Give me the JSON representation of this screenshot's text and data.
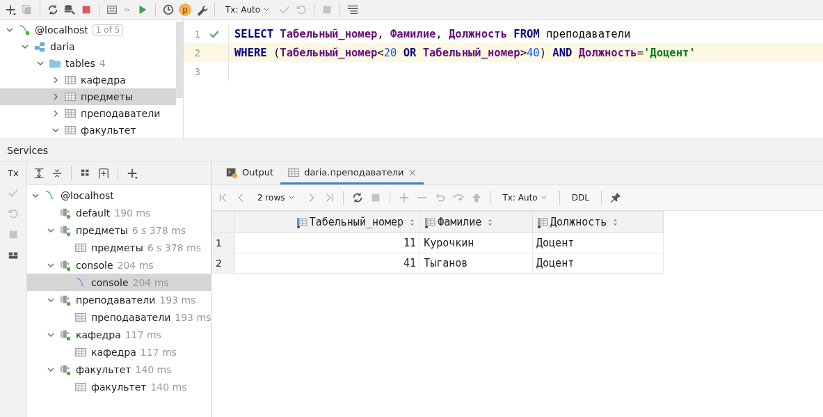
{
  "toolbar": {
    "profile_badge": "p",
    "tx_mode": "Tx: Auto"
  },
  "db_tree": [
    {
      "label": "@localhost",
      "kind": "host",
      "badge": "1 of 5",
      "expanded": true,
      "selected": false,
      "children": [
        {
          "label": "daria",
          "kind": "schema",
          "expanded": true,
          "selected": false,
          "children": [
            {
              "label": "tables",
              "kind": "folder",
              "count": "4",
              "expanded": true,
              "selected": false,
              "children": [
                {
                  "label": "кафедра",
                  "kind": "table",
                  "expanded": false,
                  "selected": false
                },
                {
                  "label": "предметы",
                  "kind": "table",
                  "expanded": false,
                  "selected": true
                },
                {
                  "label": "преподаватели",
                  "kind": "table",
                  "expanded": false,
                  "selected": false
                },
                {
                  "label": "факультет",
                  "kind": "table",
                  "expanded": true,
                  "selected": false
                }
              ]
            }
          ]
        }
      ]
    }
  ],
  "editor": {
    "lines": [
      {
        "number": "1",
        "executed": true,
        "current": false,
        "tokens": [
          {
            "text": "SELECT ",
            "kind": "keyword"
          },
          {
            "text": "Табельный_номер",
            "kind": "column"
          },
          {
            "text": ", ",
            "kind": "plain"
          },
          {
            "text": "Фамилие",
            "kind": "column"
          },
          {
            "text": ", ",
            "kind": "plain"
          },
          {
            "text": "Должность",
            "kind": "column"
          },
          {
            "text": " FROM",
            "kind": "keyword"
          },
          {
            "text": " преподаватели",
            "kind": "plain"
          }
        ]
      },
      {
        "number": "2",
        "executed": false,
        "current": true,
        "tokens": [
          {
            "text": "WHERE ",
            "kind": "keyword"
          },
          {
            "text": "(",
            "kind": "plain"
          },
          {
            "text": "Табельный_номер",
            "kind": "column"
          },
          {
            "text": "<",
            "kind": "plain"
          },
          {
            "text": "20",
            "kind": "number"
          },
          {
            "text": " OR ",
            "kind": "keyword"
          },
          {
            "text": "Табельный_номер",
            "kind": "column"
          },
          {
            "text": ">",
            "kind": "plain"
          },
          {
            "text": "40",
            "kind": "number"
          },
          {
            "text": ") ",
            "kind": "plain"
          },
          {
            "text": "AND ",
            "kind": "keyword"
          },
          {
            "text": "Должность",
            "kind": "column"
          },
          {
            "text": "=",
            "kind": "plain"
          },
          {
            "text": "'Доцент'",
            "kind": "string"
          }
        ]
      },
      {
        "number": "3",
        "executed": false,
        "current": false
      }
    ]
  },
  "services": {
    "title": "Services",
    "tx_label": "Tx",
    "tree": [
      {
        "label": "@localhost",
        "kind": "host",
        "expanded": true,
        "selected": false,
        "children": [
          {
            "label": "default",
            "time": "190 ms",
            "kind": "session",
            "selected": false
          },
          {
            "label": "предметы",
            "time": "6 s 378 ms",
            "kind": "session",
            "expanded": true,
            "selected": false,
            "children": [
              {
                "label": "предметы",
                "time": "6 s 378 ms",
                "kind": "table",
                "selected": false
              }
            ]
          },
          {
            "label": "console",
            "time": "204 ms",
            "kind": "session",
            "expanded": true,
            "selected": false,
            "children": [
              {
                "label": "console",
                "time": "204 ms",
                "kind": "console",
                "selected": true
              }
            ]
          },
          {
            "label": "преподаватели",
            "time": "193 ms",
            "kind": "session",
            "expanded": true,
            "selected": false,
            "children": [
              {
                "label": "преподаватели",
                "time": "193 ms",
                "kind": "table",
                "selected": false
              }
            ]
          },
          {
            "label": "кафедра",
            "time": "117 ms",
            "kind": "session",
            "expanded": true,
            "selected": false,
            "children": [
              {
                "label": "кафедра",
                "time": "117 ms",
                "kind": "table",
                "selected": false
              }
            ]
          },
          {
            "label": "факультет",
            "time": "140 ms",
            "kind": "session",
            "expanded": true,
            "selected": false,
            "children": [
              {
                "label": "факультет",
                "time": "140 ms",
                "kind": "table",
                "selected": false
              }
            ]
          }
        ]
      }
    ]
  },
  "results": {
    "tabs": [
      {
        "label": "Output",
        "kind": "output",
        "selected": false
      },
      {
        "label": "daria.преподаватели",
        "kind": "table",
        "selected": true,
        "close": "×"
      }
    ],
    "rows_label": "2 rows",
    "tx_mode": "Tx: Auto",
    "ddl": "DDL",
    "table": {
      "columns": [
        {
          "name": "Табельный_номер",
          "primary_key": true
        },
        {
          "name": "Фамилие",
          "primary_key": false
        },
        {
          "name": "Должность",
          "primary_key": false
        }
      ],
      "rows": [
        {
          "number": "1",
          "cells": [
            "11",
            "Курочкин",
            "Доцент"
          ]
        },
        {
          "number": "2",
          "cells": [
            "41",
            "Тыганов",
            "Доцент"
          ]
        }
      ]
    }
  }
}
